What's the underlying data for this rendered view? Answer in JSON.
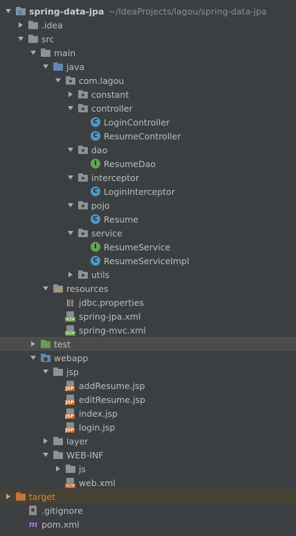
{
  "project": {
    "name": "spring-data-jpa",
    "path": "~/IdeaProjects/lagou/spring-data-jpa"
  },
  "tree": [
    {
      "label": "spring-data-jpa",
      "icon": "module-folder-icon",
      "level": 0,
      "state": "expanded",
      "bold": true,
      "path_label": "~/IdeaProjects/lagou/spring-data-jpa"
    },
    {
      "label": ".idea",
      "icon": "folder-icon",
      "level": 1,
      "state": "collapsed"
    },
    {
      "label": "src",
      "icon": "folder-icon",
      "level": 1,
      "state": "expanded"
    },
    {
      "label": "main",
      "icon": "folder-icon",
      "level": 2,
      "state": "expanded"
    },
    {
      "label": "java",
      "icon": "source-folder-icon",
      "level": 3,
      "state": "expanded"
    },
    {
      "label": "com.lagou",
      "icon": "package-icon",
      "level": 4,
      "state": "expanded"
    },
    {
      "label": "constant",
      "icon": "package-icon",
      "level": 5,
      "state": "collapsed"
    },
    {
      "label": "controller",
      "icon": "package-icon",
      "level": 5,
      "state": "expanded"
    },
    {
      "label": "LoginController",
      "icon": "class-icon",
      "level": 6,
      "state": "leaf"
    },
    {
      "label": "ResumeController",
      "icon": "class-icon",
      "level": 6,
      "state": "leaf"
    },
    {
      "label": "dao",
      "icon": "package-icon",
      "level": 5,
      "state": "expanded"
    },
    {
      "label": "ResumeDao",
      "icon": "interface-icon",
      "level": 6,
      "state": "leaf"
    },
    {
      "label": "interceptor",
      "icon": "package-icon",
      "level": 5,
      "state": "expanded"
    },
    {
      "label": "LoginInterceptor",
      "icon": "class-icon",
      "level": 6,
      "state": "leaf"
    },
    {
      "label": "pojo",
      "icon": "package-icon",
      "level": 5,
      "state": "expanded"
    },
    {
      "label": "Resume",
      "icon": "class-icon",
      "level": 6,
      "state": "leaf"
    },
    {
      "label": "service",
      "icon": "package-icon",
      "level": 5,
      "state": "expanded"
    },
    {
      "label": "ResumeService",
      "icon": "interface-icon",
      "level": 6,
      "state": "leaf"
    },
    {
      "label": "ResumeServiceImpl",
      "icon": "class-icon",
      "level": 6,
      "state": "leaf"
    },
    {
      "label": "utils",
      "icon": "package-icon",
      "level": 5,
      "state": "collapsed"
    },
    {
      "label": "resources",
      "icon": "resources-folder-icon",
      "level": 3,
      "state": "expanded"
    },
    {
      "label": "jdbc.properties",
      "icon": "properties-file-icon",
      "level": 4,
      "state": "leaf"
    },
    {
      "label": "spring-jpa.xml",
      "icon": "spring-xml-icon",
      "level": 4,
      "state": "leaf"
    },
    {
      "label": "spring-mvc.xml",
      "icon": "spring-xml-icon",
      "level": 4,
      "state": "leaf"
    },
    {
      "label": "test",
      "icon": "test-folder-icon",
      "level": 2,
      "state": "collapsed",
      "selected": true
    },
    {
      "label": "webapp",
      "icon": "web-folder-icon",
      "level": 2,
      "state": "expanded"
    },
    {
      "label": "jsp",
      "icon": "folder-icon",
      "level": 3,
      "state": "expanded"
    },
    {
      "label": "addResume.jsp",
      "icon": "jsp-file-icon",
      "level": 4,
      "state": "leaf"
    },
    {
      "label": "editResume.jsp",
      "icon": "jsp-file-icon",
      "level": 4,
      "state": "leaf"
    },
    {
      "label": "index.jsp",
      "icon": "jsp-file-icon",
      "level": 4,
      "state": "leaf"
    },
    {
      "label": "login.jsp",
      "icon": "jsp-file-icon",
      "level": 4,
      "state": "leaf"
    },
    {
      "label": "layer",
      "icon": "folder-icon",
      "level": 3,
      "state": "collapsed"
    },
    {
      "label": "WEB-INF",
      "icon": "folder-icon",
      "level": 3,
      "state": "expanded"
    },
    {
      "label": "js",
      "icon": "folder-icon",
      "level": 4,
      "state": "collapsed"
    },
    {
      "label": "web.xml",
      "icon": "web-xml-icon",
      "level": 4,
      "state": "leaf"
    },
    {
      "label": "target",
      "icon": "excluded-folder-icon",
      "level": 0,
      "state": "collapsed",
      "excluded": true
    },
    {
      "label": ".gitignore",
      "icon": "gitignore-file-icon",
      "level": 1,
      "state": "leaf"
    },
    {
      "label": "pom.xml",
      "icon": "maven-icon",
      "level": 1,
      "state": "leaf"
    }
  ]
}
